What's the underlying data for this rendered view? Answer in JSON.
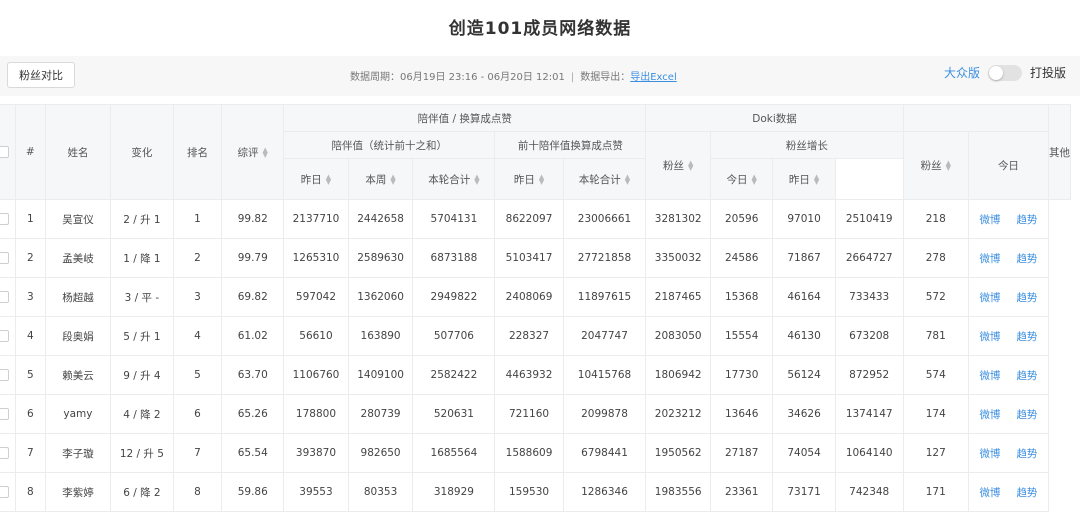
{
  "page": {
    "title": "创造101成员网络数据"
  },
  "toolbar": {
    "fans_compare": "粉丝对比",
    "period_text": "数据周期：06月19日 23:16 - 06月20日 12:01",
    "separator": "|",
    "export_prefix": "数据导出：",
    "export_link": "导出Excel",
    "mode_public": "大众版",
    "mode_vote": "打投版",
    "toggle_on": false
  },
  "header": {
    "index": "#",
    "name": "姓名",
    "change": "变化",
    "rank": "排名",
    "score": "综评",
    "companion_group": "陪伴值 / 换算成点赞",
    "companion_sub": "陪伴值（统计前十之和）",
    "convert_sub": "前十陪伴值换算成点赞",
    "doki_group": "Doki数据",
    "doki_fans": "粉丝",
    "fans_growth": "粉丝增长",
    "yesterday": "昨日",
    "this_week": "本周",
    "round_total": "本轮合计",
    "today": "今日",
    "fans2": "粉丝",
    "today2": "今日",
    "other": "其他"
  },
  "links": {
    "weibo": "微博",
    "trend": "趋势"
  },
  "rows": [
    {
      "idx": "1",
      "name": "吴宣仪",
      "change": "2 / 升 1",
      "rank": "1",
      "score": "99.82",
      "c_yest": "2137710",
      "c_week": "2442658",
      "c_total": "5704131",
      "l_yest": "8622097",
      "l_total": "23006661",
      "doki": "3281302",
      "g_today": "20596",
      "g_yest": "97010",
      "fans2": "2510419",
      "today2": "218"
    },
    {
      "idx": "2",
      "name": "孟美岐",
      "change": "1 / 降 1",
      "rank": "2",
      "score": "99.79",
      "c_yest": "1265310",
      "c_week": "2589630",
      "c_total": "6873188",
      "l_yest": "5103417",
      "l_total": "27721858",
      "doki": "3350032",
      "g_today": "24586",
      "g_yest": "71867",
      "fans2": "2664727",
      "today2": "278"
    },
    {
      "idx": "3",
      "name": "杨超越",
      "change": "3 / 平 -",
      "rank": "3",
      "score": "69.82",
      "c_yest": "597042",
      "c_week": "1362060",
      "c_total": "2949822",
      "l_yest": "2408069",
      "l_total": "11897615",
      "doki": "2187465",
      "g_today": "15368",
      "g_yest": "46164",
      "fans2": "733433",
      "today2": "572"
    },
    {
      "idx": "4",
      "name": "段奥娟",
      "change": "5 / 升 1",
      "rank": "4",
      "score": "61.02",
      "c_yest": "56610",
      "c_week": "163890",
      "c_total": "507706",
      "l_yest": "228327",
      "l_total": "2047747",
      "doki": "2083050",
      "g_today": "15554",
      "g_yest": "46130",
      "fans2": "673208",
      "today2": "781"
    },
    {
      "idx": "5",
      "name": "赖美云",
      "change": "9 / 升 4",
      "rank": "5",
      "score": "63.70",
      "c_yest": "1106760",
      "c_week": "1409100",
      "c_total": "2582422",
      "l_yest": "4463932",
      "l_total": "10415768",
      "doki": "1806942",
      "g_today": "17730",
      "g_yest": "56124",
      "fans2": "872952",
      "today2": "574"
    },
    {
      "idx": "6",
      "name": "yamy",
      "change": "4 / 降 2",
      "rank": "6",
      "score": "65.26",
      "c_yest": "178800",
      "c_week": "280739",
      "c_total": "520631",
      "l_yest": "721160",
      "l_total": "2099878",
      "doki": "2023212",
      "g_today": "13646",
      "g_yest": "34626",
      "fans2": "1374147",
      "today2": "174"
    },
    {
      "idx": "7",
      "name": "李子璇",
      "change": "12 / 升 5",
      "rank": "7",
      "score": "65.54",
      "c_yest": "393870",
      "c_week": "982650",
      "c_total": "1685564",
      "l_yest": "1588609",
      "l_total": "6798441",
      "doki": "1950562",
      "g_today": "27187",
      "g_yest": "74054",
      "fans2": "1064140",
      "today2": "127"
    },
    {
      "idx": "8",
      "name": "李紫婷",
      "change": "6 / 降 2",
      "rank": "8",
      "score": "59.86",
      "c_yest": "39553",
      "c_week": "80353",
      "c_total": "318929",
      "l_yest": "159530",
      "l_total": "1286346",
      "doki": "1983556",
      "g_today": "23361",
      "g_yest": "73171",
      "fans2": "742348",
      "today2": "171"
    }
  ]
}
